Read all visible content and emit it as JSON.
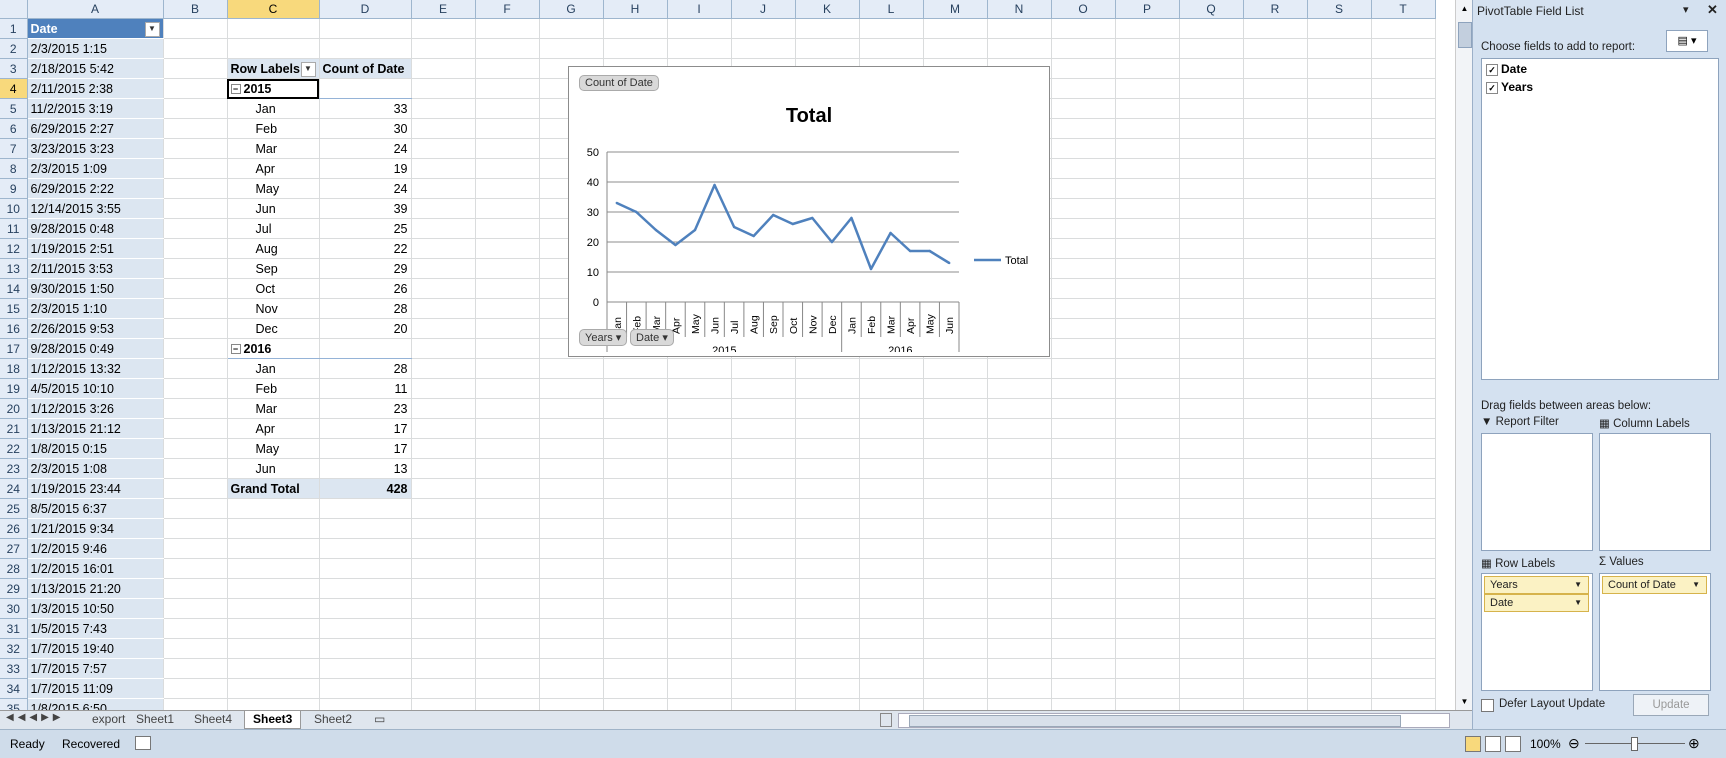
{
  "sheet": {
    "columns": [
      "A",
      "B",
      "C",
      "D",
      "E",
      "F",
      "G",
      "H",
      "I",
      "J",
      "K",
      "L",
      "M",
      "N",
      "O",
      "P",
      "Q",
      "R",
      "S",
      "T"
    ],
    "row_numbers": [
      "1",
      "2",
      "3",
      "4",
      "5",
      "6",
      "7",
      "8",
      "9",
      "10",
      "11",
      "12",
      "13",
      "14",
      "15",
      "16",
      "17",
      "18",
      "19",
      "20",
      "21",
      "22",
      "23",
      "24",
      "25",
      "26",
      "27",
      "28",
      "29",
      "30",
      "31",
      "32",
      "33",
      "34",
      "35"
    ],
    "col_a": [
      "Date",
      "2/3/2015 1:15",
      "2/18/2015 5:42",
      "2/11/2015 2:38",
      "11/2/2015 3:19",
      "6/29/2015 2:27",
      "3/23/2015 3:23",
      "2/3/2015 1:09",
      "6/29/2015 2:22",
      "12/14/2015 3:55",
      "9/28/2015 0:48",
      "1/19/2015 2:51",
      "2/11/2015 3:53",
      "9/30/2015 1:50",
      "2/3/2015 1:10",
      "2/26/2015 9:53",
      "9/28/2015 0:49",
      "1/12/2015 13:32",
      "4/5/2015 10:10",
      "1/12/2015 3:26",
      "1/13/2015 21:12",
      "1/8/2015 0:15",
      "2/3/2015 1:08",
      "1/19/2015 23:44",
      "8/5/2015 6:37",
      "1/21/2015 9:34",
      "1/2/2015 9:46",
      "1/2/2015 16:01",
      "1/13/2015 21:20",
      "1/3/2015 10:50",
      "1/5/2015 7:43",
      "1/7/2015 19:40",
      "1/7/2015 7:57",
      "1/7/2015 11:09",
      "1/8/2015 6:50"
    ],
    "pivot": {
      "row_labels_header": "Row Labels",
      "count_header": "Count of Date",
      "rows": [
        {
          "label": "2015",
          "value": "",
          "type": "year"
        },
        {
          "label": "Jan",
          "value": "33",
          "type": "month"
        },
        {
          "label": "Feb",
          "value": "30",
          "type": "month"
        },
        {
          "label": "Mar",
          "value": "24",
          "type": "month"
        },
        {
          "label": "Apr",
          "value": "19",
          "type": "month"
        },
        {
          "label": "May",
          "value": "24",
          "type": "month"
        },
        {
          "label": "Jun",
          "value": "39",
          "type": "month"
        },
        {
          "label": "Jul",
          "value": "25",
          "type": "month"
        },
        {
          "label": "Aug",
          "value": "22",
          "type": "month"
        },
        {
          "label": "Sep",
          "value": "29",
          "type": "month"
        },
        {
          "label": "Oct",
          "value": "26",
          "type": "month"
        },
        {
          "label": "Nov",
          "value": "28",
          "type": "month"
        },
        {
          "label": "Dec",
          "value": "20",
          "type": "month"
        },
        {
          "label": "2016",
          "value": "",
          "type": "year"
        },
        {
          "label": "Jan",
          "value": "28",
          "type": "month"
        },
        {
          "label": "Feb",
          "value": "11",
          "type": "month"
        },
        {
          "label": "Mar",
          "value": "23",
          "type": "month"
        },
        {
          "label": "Apr",
          "value": "17",
          "type": "month"
        },
        {
          "label": "May",
          "value": "17",
          "type": "month"
        },
        {
          "label": "Jun",
          "value": "13",
          "type": "month"
        }
      ],
      "grand_total_label": "Grand Total",
      "grand_total_value": "428"
    }
  },
  "chart_data": {
    "type": "line",
    "title": "Total",
    "categories": [
      "Jan",
      "Feb",
      "Mar",
      "Apr",
      "May",
      "Jun",
      "Jul",
      "Aug",
      "Sep",
      "Oct",
      "Nov",
      "Dec",
      "Jan",
      "Feb",
      "Mar",
      "Apr",
      "May",
      "Jun"
    ],
    "groups": [
      {
        "label": "2015",
        "count": 12
      },
      {
        "label": "2016",
        "count": 6
      }
    ],
    "series": [
      {
        "name": "Total",
        "values": [
          33,
          30,
          24,
          19,
          24,
          39,
          25,
          22,
          29,
          26,
          28,
          20,
          28,
          11,
          23,
          17,
          17,
          13
        ],
        "color": "#4f81bd"
      }
    ],
    "ylim": [
      0,
      50
    ],
    "yticks": [
      "0",
      "10",
      "20",
      "30",
      "40",
      "50"
    ],
    "grid": true,
    "legend": "right",
    "value_button": "Count of Date",
    "axis_buttons": [
      "Years",
      "Date"
    ]
  },
  "tabs": [
    "export",
    "Sheet1",
    "Sheet4",
    "Sheet3",
    "Sheet2"
  ],
  "active_tab": "Sheet3",
  "status": {
    "ready": "Ready",
    "recovered": "Recovered",
    "zoom": "100%"
  },
  "pane": {
    "title": "PivotTable Field List",
    "choose": "Choose fields to add to report:",
    "fields": [
      "Date",
      "Years"
    ],
    "drag": "Drag fields between areas below:",
    "report_filter": "Report Filter",
    "column_labels": "Column Labels",
    "row_labels": "Row Labels",
    "values": "Values",
    "row_fields": [
      "Years",
      "Date"
    ],
    "value_fields": [
      "Count of Date"
    ],
    "defer": "Defer Layout Update",
    "update": "Update"
  }
}
